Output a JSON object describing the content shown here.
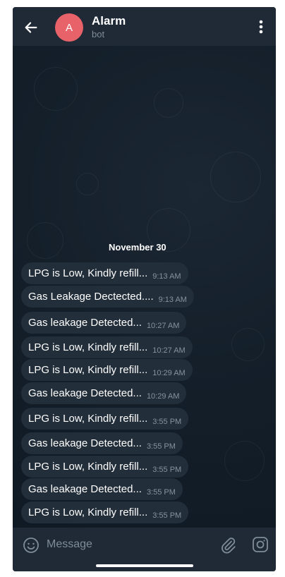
{
  "header": {
    "avatar_letter": "A",
    "title": "Alarm",
    "subtitle": "bot"
  },
  "chat": {
    "date": "November 30",
    "messages": [
      {
        "text": "LPG is Low, Kindly refill...",
        "time": "9:13 AM"
      },
      {
        "text": "Gas Leakage Dectected....",
        "time": "9:13 AM"
      },
      {
        "text": "Gas leakage Detected...",
        "time": "10:27 AM"
      },
      {
        "text": "LPG is Low, Kindly refill...",
        "time": "10:27 AM"
      },
      {
        "text": "LPG is Low, Kindly refill...",
        "time": "10:29 AM"
      },
      {
        "text": "Gas leakage Detected...",
        "time": "10:29 AM"
      },
      {
        "text": "LPG is Low, Kindly refill...",
        "time": "3:55 PM"
      },
      {
        "text": "Gas leakage Detected...",
        "time": "3:55 PM"
      },
      {
        "text": "LPG is Low, Kindly refill...",
        "time": "3:55 PM"
      },
      {
        "text": "Gas leakage Detected...",
        "time": "3:55 PM"
      },
      {
        "text": "LPG is Low, Kindly refill...",
        "time": "3:55 PM"
      }
    ]
  },
  "composer": {
    "placeholder": "Message"
  },
  "icons": {
    "back": "arrow-left-icon",
    "menu": "more-vertical-icon",
    "emoji": "emoji-icon",
    "attach": "paperclip-icon",
    "camera": "instagram-camera-icon"
  },
  "colors": {
    "background": "#0f1923",
    "header": "#1f2a36",
    "bubble": "#222e3a",
    "avatar": "#e8626a",
    "time": "#8593a1"
  }
}
